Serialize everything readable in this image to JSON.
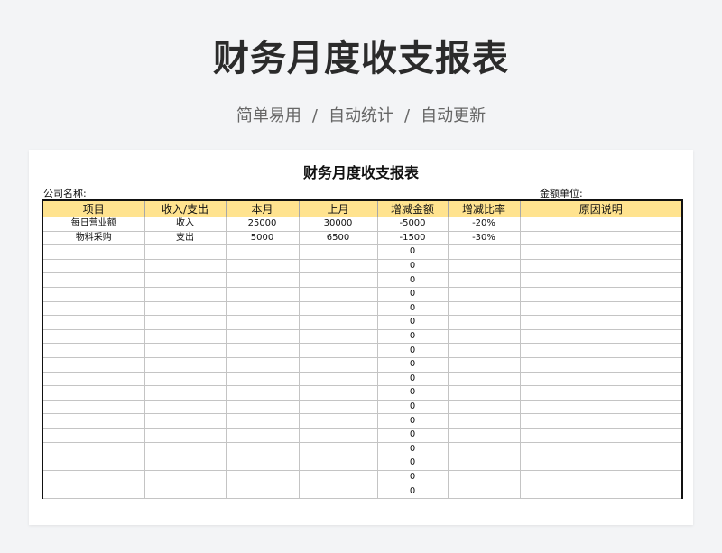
{
  "banner": {
    "title": "财务月度收支报表",
    "tags": [
      "简单易用",
      "自动统计",
      "自动更新"
    ],
    "separator": "/"
  },
  "sheet": {
    "title": "财务月度收支报表",
    "company_label": "公司名称:",
    "unit_label": "金额单位:",
    "columns": [
      "项目",
      "收入/支出",
      "本月",
      "上月",
      "增减金额",
      "增减比率",
      "原因说明"
    ],
    "rows": [
      [
        "每日营业额",
        "收入",
        "25000",
        "30000",
        "-5000",
        "-20%",
        ""
      ],
      [
        "物料采购",
        "支出",
        "5000",
        "6500",
        "-1500",
        "-30%",
        ""
      ],
      [
        "",
        "",
        "",
        "",
        "0",
        "",
        ""
      ],
      [
        "",
        "",
        "",
        "",
        "0",
        "",
        ""
      ],
      [
        "",
        "",
        "",
        "",
        "0",
        "",
        ""
      ],
      [
        "",
        "",
        "",
        "",
        "0",
        "",
        ""
      ],
      [
        "",
        "",
        "",
        "",
        "0",
        "",
        ""
      ],
      [
        "",
        "",
        "",
        "",
        "0",
        "",
        ""
      ],
      [
        "",
        "",
        "",
        "",
        "0",
        "",
        ""
      ],
      [
        "",
        "",
        "",
        "",
        "0",
        "",
        ""
      ],
      [
        "",
        "",
        "",
        "",
        "0",
        "",
        ""
      ],
      [
        "",
        "",
        "",
        "",
        "0",
        "",
        ""
      ],
      [
        "",
        "",
        "",
        "",
        "0",
        "",
        ""
      ],
      [
        "",
        "",
        "",
        "",
        "0",
        "",
        ""
      ],
      [
        "",
        "",
        "",
        "",
        "0",
        "",
        ""
      ],
      [
        "",
        "",
        "",
        "",
        "0",
        "",
        ""
      ],
      [
        "",
        "",
        "",
        "",
        "0",
        "",
        ""
      ],
      [
        "",
        "",
        "",
        "",
        "0",
        "",
        ""
      ],
      [
        "",
        "",
        "",
        "",
        "0",
        "",
        ""
      ],
      [
        "",
        "",
        "",
        "",
        "0",
        "",
        ""
      ]
    ]
  },
  "colors": {
    "header_fill": "#ffe38f",
    "background": "#f3f4f6",
    "sheet": "#ffffff"
  }
}
